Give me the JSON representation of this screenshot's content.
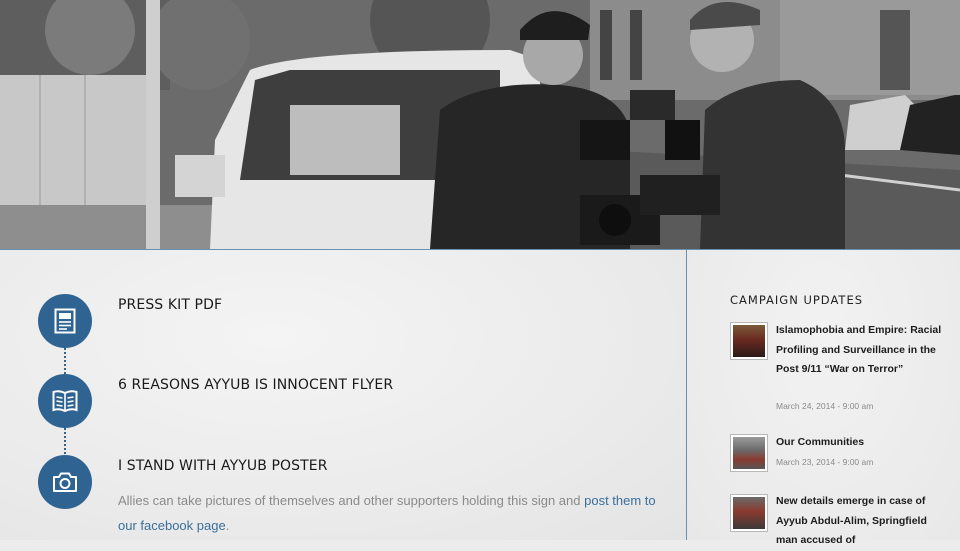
{
  "hero": {
    "image": "two men operating a video camera next to a white SUV on a city street (grayscale)"
  },
  "resources": {
    "items": [
      {
        "title": "PRESS KIT PDF",
        "icon": "document-icon"
      },
      {
        "title": "6 REASONS AYYUB IS INNOCENT FLYER",
        "icon": "book-icon"
      },
      {
        "title": "I STAND WITH AYYUB POSTER",
        "icon": "camera-icon"
      }
    ],
    "poster_desc": "Allies can take pictures of themselves and other supporters holding this sign and ",
    "poster_link": "post them to our facebook page",
    "poster_period": "."
  },
  "sidebar": {
    "heading": "CAMPAIGN UPDATES",
    "posts": [
      {
        "title": "Islamophobia and Empire: Racial Profiling and Surveillance in the Post 9/11 “War on Terror”",
        "date": "March 24, 2014 - 9:00 am"
      },
      {
        "title": "Our Communities",
        "date": "March 23, 2014 - 9:00 am"
      },
      {
        "title": "New details emerge in case of Ayyub Abdul-Alim, Springfield man accused of",
        "date": ""
      }
    ]
  },
  "colors": {
    "accent": "#2f6391",
    "link": "#3a6f9c",
    "divider": "#6a90ad"
  }
}
